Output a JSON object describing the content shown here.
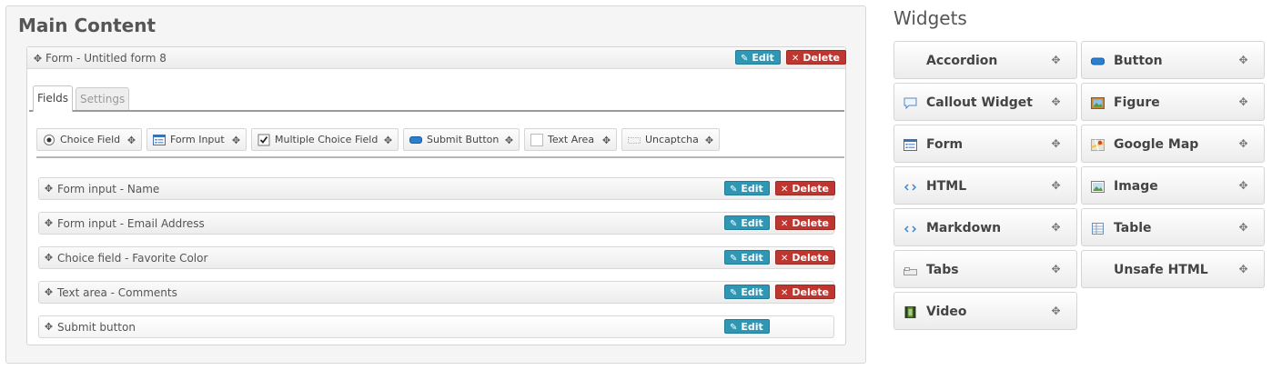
{
  "main": {
    "title": "Main Content",
    "form": {
      "title": "Form - Untitled form 8",
      "edit_label": "Edit",
      "delete_label": "Delete",
      "tabs": [
        {
          "label": "Fields",
          "active": true
        },
        {
          "label": "Settings",
          "active": false
        }
      ],
      "field_types": [
        {
          "label": "Choice Field",
          "icon": "radio-icon"
        },
        {
          "label": "Form Input",
          "icon": "form-input-icon"
        },
        {
          "label": "Multiple Choice Field",
          "icon": "checkbox-icon"
        },
        {
          "label": "Submit Button",
          "icon": "button-icon"
        },
        {
          "label": "Text Area",
          "icon": "textarea-icon"
        },
        {
          "label": "Uncaptcha",
          "icon": "captcha-icon"
        }
      ],
      "rows": [
        {
          "label": "Form input - Name",
          "edit": "Edit",
          "delete": "Delete"
        },
        {
          "label": "Form input - Email Address",
          "edit": "Edit",
          "delete": "Delete"
        },
        {
          "label": "Choice field - Favorite Color",
          "edit": "Edit",
          "delete": "Delete"
        },
        {
          "label": "Text area - Comments",
          "edit": "Edit",
          "delete": "Delete"
        },
        {
          "label": "Submit button",
          "edit": "Edit",
          "delete": null
        }
      ]
    }
  },
  "widgets": {
    "title": "Widgets",
    "items": [
      {
        "label": "Accordion",
        "icon": null
      },
      {
        "label": "Button",
        "icon": "button-icon"
      },
      {
        "label": "Callout Widget",
        "icon": "callout-icon"
      },
      {
        "label": "Figure",
        "icon": "figure-icon"
      },
      {
        "label": "Form",
        "icon": "form-icon"
      },
      {
        "label": "Google Map",
        "icon": "map-icon"
      },
      {
        "label": "HTML",
        "icon": "code-icon"
      },
      {
        "label": "Image",
        "icon": "image-icon"
      },
      {
        "label": "Markdown",
        "icon": "code-icon"
      },
      {
        "label": "Table",
        "icon": "table-icon"
      },
      {
        "label": "Tabs",
        "icon": "tabs-icon"
      },
      {
        "label": "Unsafe HTML",
        "icon": null
      },
      {
        "label": "Video",
        "icon": "video-icon"
      }
    ]
  },
  "colors": {
    "edit": "#2f96b4",
    "delete": "#bd362f"
  }
}
